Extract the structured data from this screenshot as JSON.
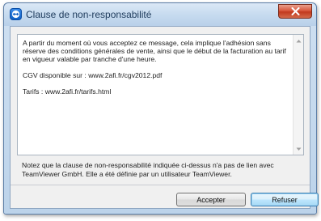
{
  "window": {
    "title": "Clause de non-responsabilité",
    "icon": "teamviewer-icon",
    "close_icon": "close-icon"
  },
  "disclaimer": {
    "paragraph1": "A partir du moment où vous acceptez ce message, cela implique l'adhésion sans réserve des conditions générales de vente, ainsi que le début de la facturation au tarif en vigueur valable par tranche d'une heure.",
    "paragraph2": "CGV disponible sur : www.2afi.fr/cgv2012.pdf",
    "paragraph3": "Tarifs : www.2afi.fr/tarifs.html"
  },
  "notice": "Notez que la clause de non-responsabilité indiquée ci-dessus n'a pas de lien avec TeamViewer GmbH. Elle a été définie par un utilisateur TeamViewer.",
  "buttons": {
    "accept": "Accepter",
    "refuse": "Refuser"
  },
  "colors": {
    "accent": "#3c7fb1",
    "close": "#c23a1e",
    "titlebar": "#c7dbef"
  }
}
